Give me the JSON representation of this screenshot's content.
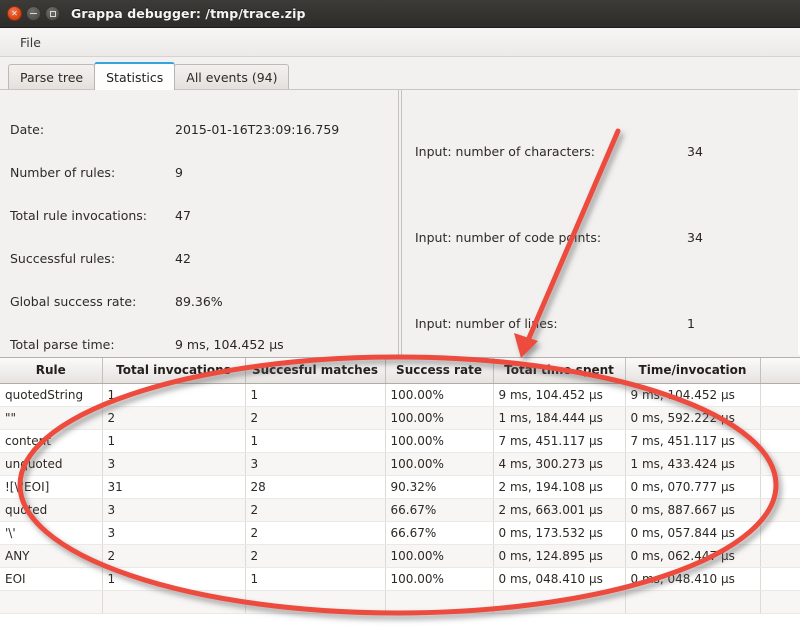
{
  "window": {
    "title": "Grappa debugger: /tmp/trace.zip",
    "close_icon": "close-icon",
    "minimize_icon": "minimize-icon",
    "maximize_icon": "maximize-icon"
  },
  "menubar": {
    "items": [
      {
        "label": "File"
      }
    ]
  },
  "tabs": [
    {
      "label": "Parse tree",
      "active": false
    },
    {
      "label": "Statistics",
      "active": true
    },
    {
      "label": "All events (94)",
      "active": false
    }
  ],
  "left_panel": {
    "rows": [
      {
        "label": "Date:",
        "value": "2015-01-16T23:09:16.759"
      },
      {
        "label": "Number of rules:",
        "value": "9"
      },
      {
        "label": "Total rule invocations:",
        "value": "47"
      },
      {
        "label": "Successful rules:",
        "value": "42"
      },
      {
        "label": "Global success rate:",
        "value": "89.36%"
      },
      {
        "label": "Total parse time:",
        "value": "9 ms, 104.452 µs"
      }
    ]
  },
  "right_panel": {
    "rows": [
      {
        "label": "Input: number of characters:",
        "value": "34"
      },
      {
        "label": "Input: number of code points:",
        "value": "34"
      },
      {
        "label": "Input: number of lines:",
        "value": "1"
      }
    ]
  },
  "table": {
    "columns": [
      "Rule",
      "Total invocations",
      "Succesful matches",
      "Success rate",
      "Total time spent",
      "Time/invocation",
      ""
    ],
    "rows": [
      [
        "quotedString",
        "1",
        "1",
        "100.00%",
        "9 ms, 104.452 µs",
        "9 ms, 104.452 µs",
        ""
      ],
      [
        "\"\"",
        "2",
        "2",
        "100.00%",
        "1 ms, 184.444 µs",
        "0 ms, 592.222 µs",
        ""
      ],
      [
        "content",
        "1",
        "1",
        "100.00%",
        "7 ms, 451.117 µs",
        "7 ms, 451.117 µs",
        ""
      ],
      [
        "unquoted",
        "3",
        "3",
        "100.00%",
        "4 ms, 300.273 µs",
        "1 ms, 433.424 µs",
        ""
      ],
      [
        "![\\\"EOI]",
        "31",
        "28",
        "90.32%",
        "2 ms, 194.108 µs",
        "0 ms, 070.777 µs",
        ""
      ],
      [
        "quoted",
        "3",
        "2",
        "66.67%",
        "2 ms, 663.001 µs",
        "0 ms, 887.667 µs",
        ""
      ],
      [
        "'\\'",
        "3",
        "2",
        "66.67%",
        "0 ms, 173.532 µs",
        "0 ms, 057.844 µs",
        ""
      ],
      [
        "ANY",
        "2",
        "2",
        "100.00%",
        "0 ms, 124.895 µs",
        "0 ms, 062.447 µs",
        ""
      ],
      [
        "EOI",
        "1",
        "1",
        "100.00%",
        "0 ms, 048.410 µs",
        "0 ms, 048.410 µs",
        ""
      ]
    ]
  },
  "annotations": {
    "accent_color": "#ed4c3c",
    "arrow": {
      "name": "red-arrow-annotation"
    },
    "ellipse": {
      "name": "red-ellipse-annotation"
    }
  }
}
